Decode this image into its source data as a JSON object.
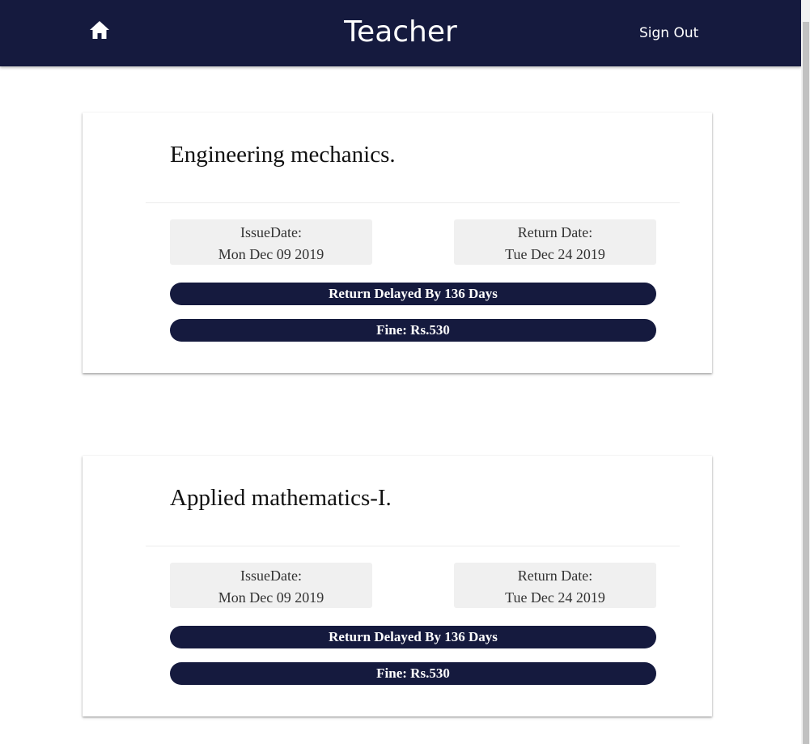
{
  "header": {
    "title": "Teacher",
    "home_icon": "home-icon",
    "signout_label": "Sign Out",
    "background_color": "#151a3e"
  },
  "books": [
    {
      "title": "Engineering mechanics.",
      "issue_label": "IssueDate:",
      "issue_date": "Mon Dec 09 2019",
      "return_label": "Return Date:",
      "return_date": "Tue Dec 24 2019",
      "delay_text": "Return Delayed By 136 Days",
      "fine_text": "Fine: Rs.530"
    },
    {
      "title": "Applied mathematics-I.",
      "issue_label": "IssueDate:",
      "issue_date": "Mon Dec 09 2019",
      "return_label": "Return Date:",
      "return_date": "Tue Dec 24 2019",
      "delay_text": "Return Delayed By 136 Days",
      "fine_text": "Fine: Rs.530"
    }
  ],
  "colors": {
    "accent": "#151a3e",
    "date_box_bg": "#f0f0f0"
  }
}
